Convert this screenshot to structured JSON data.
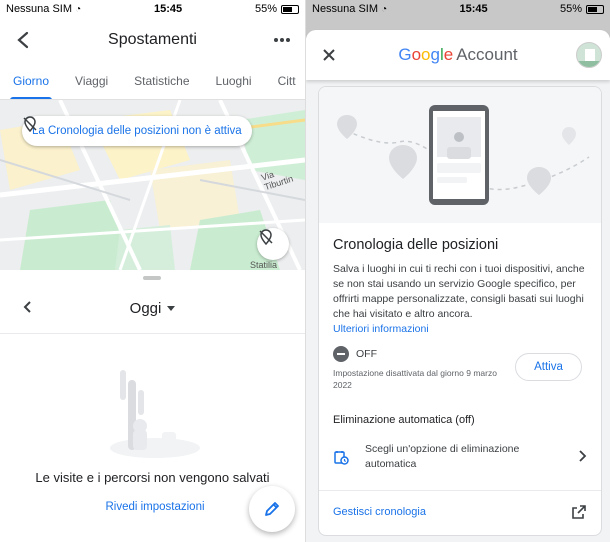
{
  "left": {
    "status": {
      "carrier": "Nessuna SIM",
      "time": "15:45",
      "battery": "55%"
    },
    "header": {
      "title": "Spostamenti"
    },
    "tabs": [
      {
        "label": "Giorno",
        "active": true
      },
      {
        "label": "Viaggi",
        "active": false
      },
      {
        "label": "Statistiche",
        "active": false
      },
      {
        "label": "Luoghi",
        "active": false
      },
      {
        "label": "Citt",
        "active": false
      }
    ],
    "map": {
      "notice": "La Cronologia delle posizioni non è attiva",
      "street_labels": [
        "Via Tiburtin",
        "Statilia"
      ]
    },
    "sheet": {
      "date": "Oggi",
      "empty_message": "Le visite e i percorsi non vengono salvati",
      "review_link": "Rivedi impostazioni"
    }
  },
  "right": {
    "status": {
      "carrier": "Nessuna SIM",
      "time": "15:45",
      "battery": "55%"
    },
    "brand": {
      "google": [
        "G",
        "o",
        "o",
        "g",
        "l",
        "e"
      ],
      "account": "Account"
    },
    "card": {
      "title": "Cronologia delle posizioni",
      "description": "Salva i luoghi in cui ti rechi con i tuoi dispositivi, anche se non stai usando un servizio Google specifico, per offrirti mappe personalizzate, consigli basati sui luoghi che hai visitato e altro ancora.",
      "more_link": "Ulteriori informazioni",
      "state": "OFF",
      "state_note": "Impostazione disattivata dal giorno 9 marzo 2022",
      "activate_label": "Attiva",
      "auto_delete_title": "Eliminazione automatica (off)",
      "auto_delete_option": "Scegli un'opzione di eliminazione automatica",
      "manage_link": "Gestisci cronologia"
    }
  },
  "colors": {
    "accent": "#1a73e8",
    "google_blue": "#4285f4",
    "google_red": "#ea4335",
    "google_yellow": "#fbbc05",
    "google_green": "#34a853"
  }
}
